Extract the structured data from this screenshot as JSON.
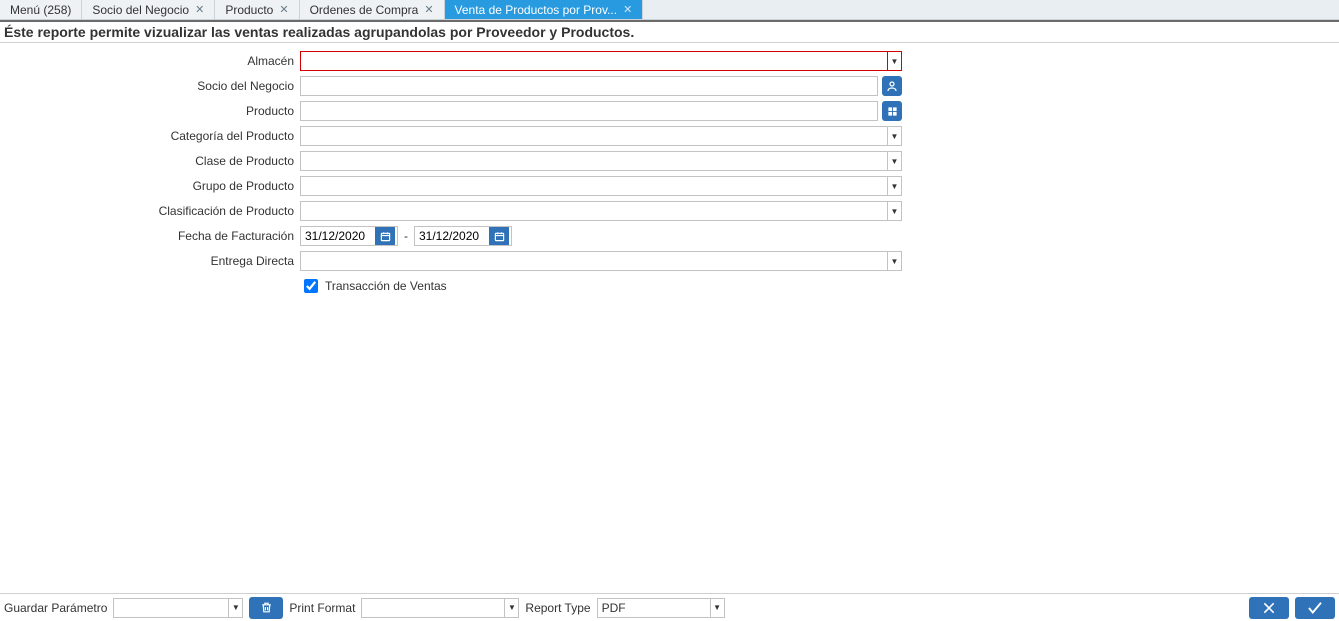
{
  "tabs": [
    {
      "label": "Menú (258)",
      "closable": false,
      "active": false
    },
    {
      "label": "Socio del Negocio",
      "closable": true,
      "active": false
    },
    {
      "label": "Producto",
      "closable": true,
      "active": false
    },
    {
      "label": "Ordenes de Compra",
      "closable": true,
      "active": false
    },
    {
      "label": "Venta de Productos por Prov...",
      "closable": true,
      "active": true
    }
  ],
  "description": "Éste reporte permite vizualizar las ventas realizadas agrupandolas por Proveedor y Productos.",
  "fields": {
    "almacen": {
      "label": "Almacén",
      "type": "combo",
      "required": true,
      "value": ""
    },
    "socio_negocio": {
      "label": "Socio del Negocio",
      "type": "lookup",
      "value": ""
    },
    "producto": {
      "label": "Producto",
      "type": "lookup",
      "value": ""
    },
    "categoria_producto": {
      "label": "Categoría del Producto",
      "type": "combo",
      "value": ""
    },
    "clase_producto": {
      "label": "Clase de Producto",
      "type": "combo",
      "value": ""
    },
    "grupo_producto": {
      "label": "Grupo de Producto",
      "type": "combo",
      "value": ""
    },
    "clasificacion_producto": {
      "label": "Clasificación de Producto",
      "type": "combo",
      "value": ""
    },
    "fecha_facturacion": {
      "label": "Fecha de Facturación",
      "type": "daterange",
      "from": "31/12/2020",
      "to": "31/12/2020"
    },
    "entrega_directa": {
      "label": "Entrega Directa",
      "type": "combo",
      "value": ""
    },
    "transaccion_ventas": {
      "label": "Transacción de Ventas",
      "type": "checkbox",
      "checked": true
    }
  },
  "footer": {
    "guardar_parametro_label": "Guardar Parámetro",
    "guardar_parametro_value": "",
    "print_format_label": "Print Format",
    "print_format_value": "",
    "report_type_label": "Report Type",
    "report_type_value": "PDF"
  }
}
